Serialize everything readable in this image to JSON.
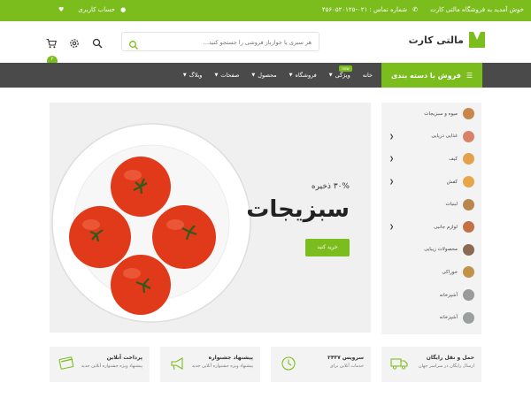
{
  "topbar": {
    "welcome": "خوش آمدید به فروشگاه مالتی کارت",
    "phone_label": "شماره تماس : ۰۲۱-۴۵۶۰۵۲۰۱۲۵",
    "account": "حساب کاربری",
    "icons": [
      "phone-icon",
      "user-icon",
      "heart-icon"
    ]
  },
  "header": {
    "logo_text": "مالتی کارت",
    "search_placeholder": "هر سبزی یا خوارباز فروشی را جستجو کنید...",
    "cart_count": "۲",
    "icons": [
      "search-icon",
      "settings-icon",
      "cart-icon"
    ]
  },
  "nav": {
    "category_button": "فروش با دسته بندی",
    "menu": [
      {
        "label": "خانه",
        "caret": false
      },
      {
        "label": "ویژگی",
        "caret": true,
        "badge": "new"
      },
      {
        "label": "فروشگاه",
        "caret": true
      },
      {
        "label": "محصول",
        "caret": true
      },
      {
        "label": "صفحات",
        "caret": true
      },
      {
        "label": "وبلاگ",
        "caret": true
      }
    ]
  },
  "hero": {
    "save_text": "۳۰% ذخیره",
    "title": "سبزیجات",
    "button": "خرید کنید"
  },
  "sidebar": {
    "items": [
      {
        "label": "میوه و سبزیجات",
        "has_arrow": false,
        "color": "#c8874a"
      },
      {
        "label": "غذایی دریایی",
        "has_arrow": true,
        "color": "#d9826a"
      },
      {
        "label": "کیف",
        "has_arrow": true,
        "color": "#e2a14c"
      },
      {
        "label": "کفش",
        "has_arrow": true,
        "color": "#e8a64a"
      },
      {
        "label": "لبنیات",
        "has_arrow": false,
        "color": "#b9864e"
      },
      {
        "label": "لوازم جانبی",
        "has_arrow": true,
        "color": "#c46f44"
      },
      {
        "label": "محصولات زیبایی",
        "has_arrow": false,
        "color": "#8a6a52"
      },
      {
        "label": "خوراکی",
        "has_arrow": false,
        "color": "#c2924a"
      },
      {
        "label": "آشپزخانه",
        "has_arrow": false,
        "color": "#9a9a9a"
      },
      {
        "label": "آشپزخانه",
        "has_arrow": false,
        "color": "#9aa0a0"
      }
    ]
  },
  "features": [
    {
      "title": "حمل و نقل رایگان",
      "subtitle": "ارسال رایگان در سراسر جهان",
      "icon": "truck-icon"
    },
    {
      "title": "سرویس ۲۴۳۷",
      "subtitle": "خدمات آنلاین برای",
      "icon": "clock-icon"
    },
    {
      "title": "پیشنهاد جشنواره",
      "subtitle": "پیشنهاد ویژه جشنواره آنلاین جدید",
      "icon": "megaphone-icon"
    },
    {
      "title": "پرداخت آنلاین",
      "subtitle": "پیشنهاد ویژه جشنواره آنلاین جدید",
      "icon": "credit-card-icon"
    }
  ],
  "colors": {
    "accent": "#7cbd1e",
    "nav_bg": "#4a4a4a",
    "panel_bg": "#f3f3f3",
    "tomato": "#e03a1a"
  }
}
